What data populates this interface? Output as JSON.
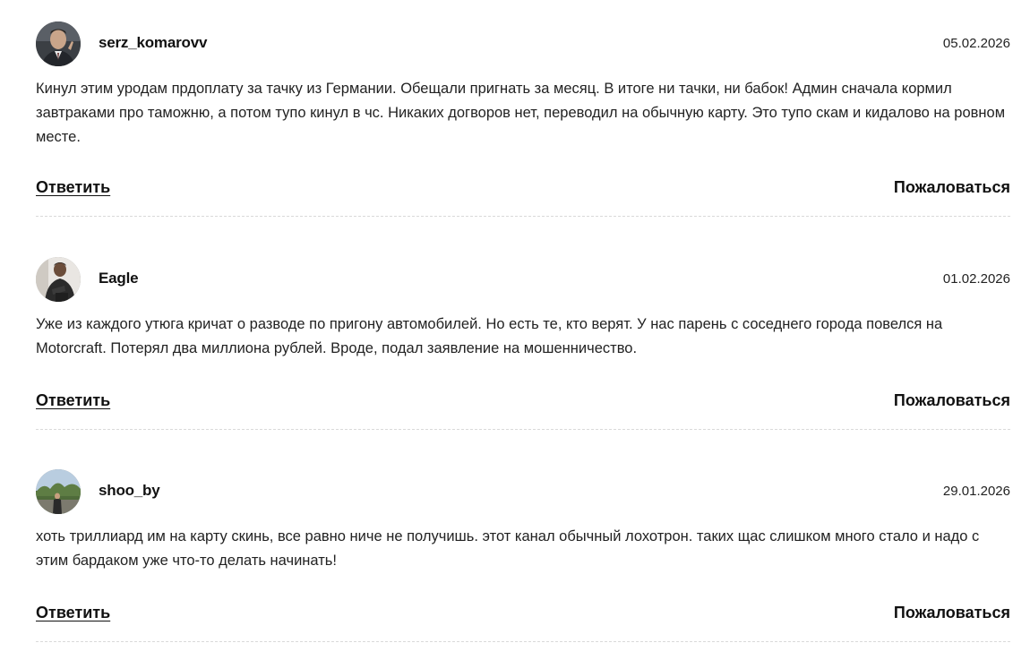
{
  "comments": [
    {
      "username": "serz_komarovv",
      "date": "05.02.2026",
      "text": "Кинул этим уродам прдоплату за тачку из Германии. Обещали пригнать за месяц. В итоге ни тачки, ни бабок! Админ сначала кормил завтраками про таможню, а потом тупо кинул в чс. Никаких догворов нет, переводил на обычную карту. Это тупо скам и кидалово на ровном месте.",
      "reply_label": "Ответить",
      "report_label": "Пожаловаться"
    },
    {
      "username": "Eagle",
      "date": "01.02.2026",
      "text": "Уже из каждого утюга кричат о разводе по пригону автомобилей. Но есть те, кто верят. У нас парень с соседнего города повелся на Motorcraft. Потерял два миллиона рублей. Вроде, подал заявление на мошенничество.",
      "reply_label": "Ответить",
      "report_label": "Пожаловаться"
    },
    {
      "username": "shoo_by",
      "date": "29.01.2026",
      "text": "хоть триллиард им на карту скинь, все равно ниче не получишь. этот канал обычный лохотрон. таких щас слишком много стало и надо с этим бардаком уже что-то делать начинать!",
      "reply_label": "Ответить",
      "report_label": "Пожаловаться"
    }
  ],
  "icons": {
    "avatar_1": "user-photo-avatar",
    "avatar_2": "user-photo-avatar",
    "avatar_3": "user-photo-avatar"
  }
}
